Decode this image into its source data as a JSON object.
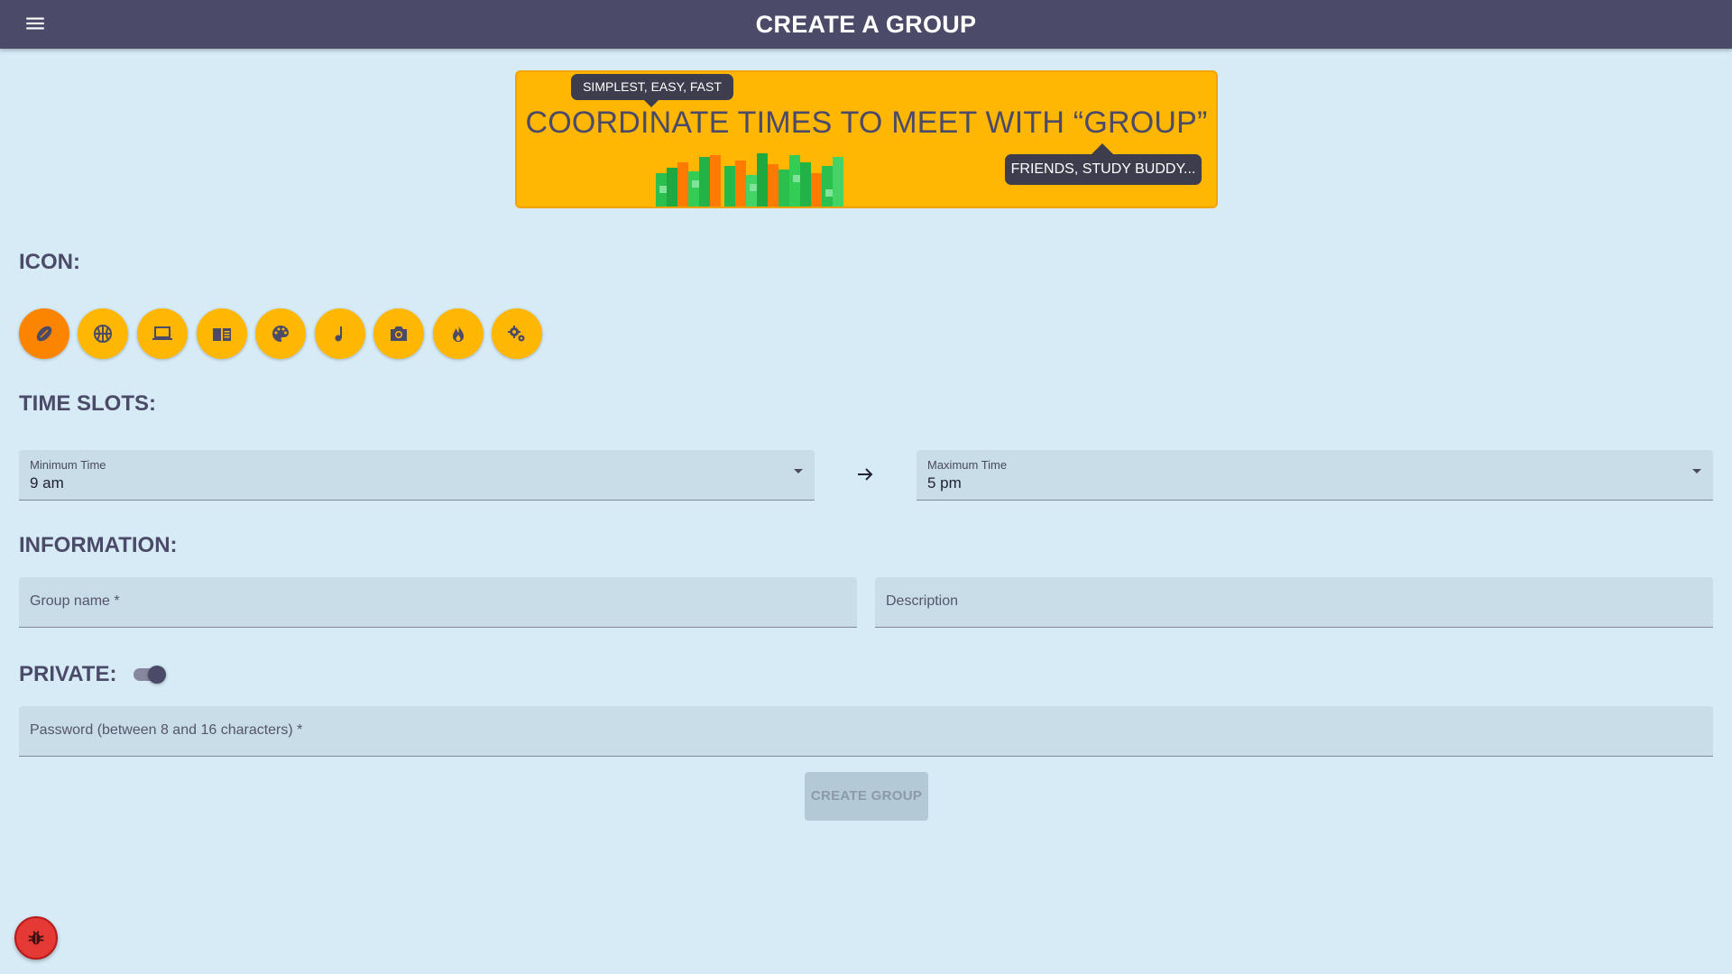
{
  "header": {
    "title": "CREATE A GROUP",
    "menu_icon": "menu-icon"
  },
  "banner": {
    "headline": "COORDINATE TIMES TO MEET WITH “GROUP”",
    "tooltip_top": "SIMPLEST, EASY, FAST",
    "tooltip_right": "FRIENDS, STUDY BUDDY..."
  },
  "icon_section": {
    "heading": "ICON:",
    "selected_index": 0,
    "icons": [
      "football-icon",
      "basketball-icon",
      "laptop-icon",
      "book-icon",
      "palette-icon",
      "music-note-icon",
      "camera-icon",
      "fire-icon",
      "gears-icon"
    ]
  },
  "time_section": {
    "heading": "TIME SLOTS:",
    "min": {
      "label": "Minimum Time",
      "value": "9 am"
    },
    "max": {
      "label": "Maximum Time",
      "value": "5 pm"
    }
  },
  "info_section": {
    "heading": "INFORMATION:",
    "group_name_placeholder": "Group name *",
    "description_placeholder": "Description"
  },
  "private_section": {
    "heading": "PRIVATE:",
    "toggle_on": true,
    "password_placeholder": "Password (between 8 and 16 characters) *"
  },
  "actions": {
    "create_label": "CREATE GROUP"
  },
  "colors": {
    "background": "#d6ebf6",
    "header": "#4b4a68",
    "accent": "#ffb703",
    "selected_icon": "#fb8500",
    "bug_button": "#e53935"
  }
}
